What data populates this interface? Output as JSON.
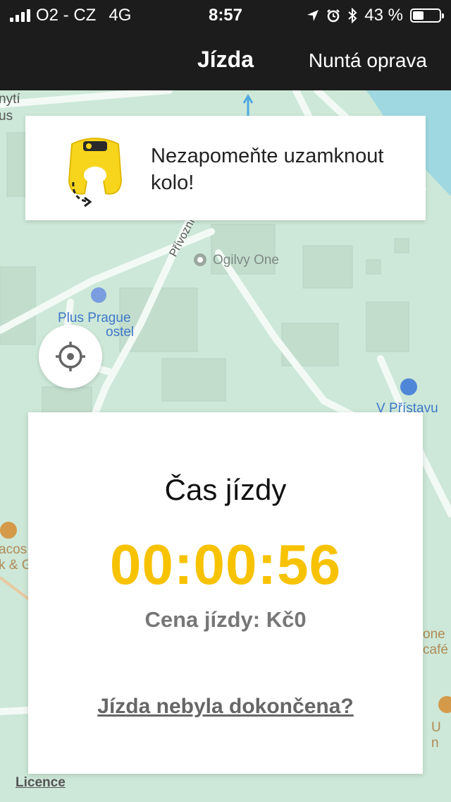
{
  "status_bar": {
    "carrier": "O2 - CZ",
    "network": "4G",
    "time": "8:57",
    "battery_text": "43 %",
    "battery_level": 0.43,
    "icons": [
      "location-arrow-icon",
      "alarm-icon",
      "bluetooth-icon"
    ]
  },
  "nav": {
    "title": "Jízda",
    "action": "Nuntá oprava"
  },
  "banner": {
    "text": "Nezapomeňte uzamknout kolo!",
    "icon": "bike-lock-icon"
  },
  "map": {
    "labels": {
      "ogilvy": "Ogilvy One",
      "hostel_1": "Plus Prague",
      "hostel_2": "ostel",
      "street_privozni": "Přívozní",
      "bus_stop": "V Přístavu",
      "left_top_1": "nytí",
      "left_top_2": "us",
      "left_mid_1": "acos",
      "left_mid_2": "k & G",
      "right_1": "one",
      "right_2": "café",
      "right_3": "U n",
      "licence": "Licence"
    },
    "colors": {
      "background": "#cde8d8",
      "road": "#ffffff",
      "water": "#9fd8e0"
    }
  },
  "ride": {
    "title": "Čas jízdy",
    "timer": "00:00:56",
    "price_label": "Cena jízdy: Kč0",
    "unfinished_link": "Jízda nebyla dokončena?"
  },
  "colors": {
    "accent": "#f7c200",
    "header_bg": "#1c1c1c"
  }
}
